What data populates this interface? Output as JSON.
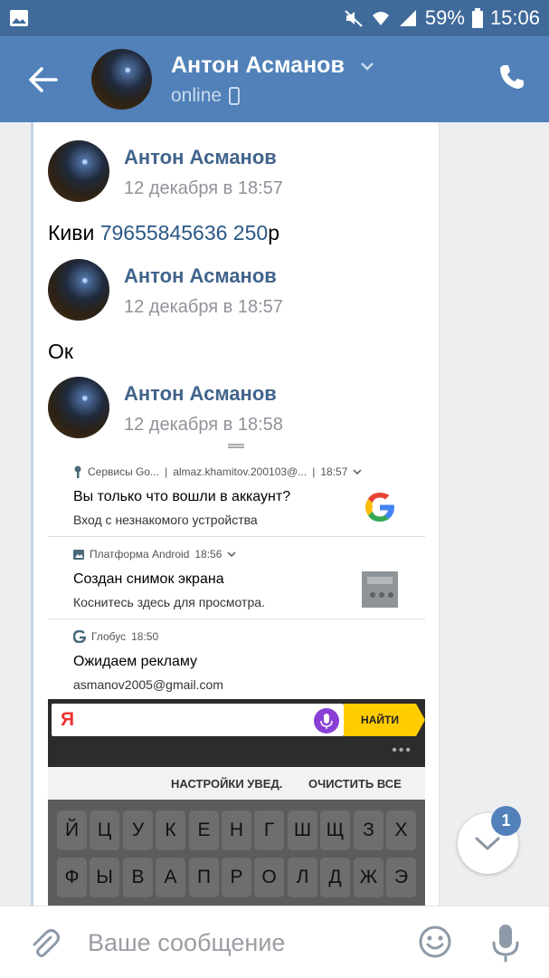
{
  "status_bar": {
    "battery": "59%",
    "time": "15:06"
  },
  "header": {
    "name": "Антон Асманов",
    "status": "online"
  },
  "messages": [
    {
      "name": "Антон Асманов",
      "date": "12 декабря в 18:57"
    },
    {
      "name": "Антон Асманов",
      "date": "12 декабря в 18:57"
    },
    {
      "name": "Антон Асманов",
      "date": "12 декабря в 18:58"
    }
  ],
  "texts": {
    "first_prefix": "Киви ",
    "first_link": "79655845636 250",
    "first_suffix": "р",
    "second": "Ок"
  },
  "screenshot": {
    "notifications": [
      {
        "app": "Сервисы Go...",
        "account": "almaz.khamitov.200103@...",
        "time": "18:57",
        "title": "Вы только что вошли в аккаунт?",
        "subtitle": "Вход с незнакомого устройства"
      },
      {
        "app": "Платформа Android",
        "time": "18:56",
        "title": "Создан снимок экрана",
        "subtitle": "Коснитесь здесь для просмотра."
      },
      {
        "app": "Глобус",
        "time": "18:50",
        "title": "Ожидаем рекламу",
        "subtitle": "asmanov2005@gmail.com"
      }
    ],
    "search": {
      "logo": "Я",
      "button": "НАЙТИ"
    },
    "actions": {
      "settings": "НАСТРОЙКИ УВЕД.",
      "clear": "ОЧИСТИТЬ ВСЕ"
    },
    "keyboard": {
      "row1": [
        "Й",
        "Ц",
        "У",
        "К",
        "Е",
        "Н",
        "Г",
        "Ш",
        "Щ",
        "З",
        "Х"
      ],
      "row2": [
        "Ф",
        "Ы",
        "В",
        "А",
        "П",
        "Р",
        "О",
        "Л",
        "Д",
        "Ж",
        "Э"
      ]
    }
  },
  "composer": {
    "placeholder": "Ваше сообщение"
  },
  "fab": {
    "badge": "1"
  },
  "colors": {
    "header": "#5181b8",
    "statusbar": "#3f6a9a",
    "link": "#2a5885",
    "name": "#42648b"
  },
  "icons": [
    "back-arrow-icon",
    "phone-icon",
    "chevron-down-icon",
    "mobile-icon",
    "paperclip-icon",
    "emoji-icon",
    "microphone-icon"
  ]
}
